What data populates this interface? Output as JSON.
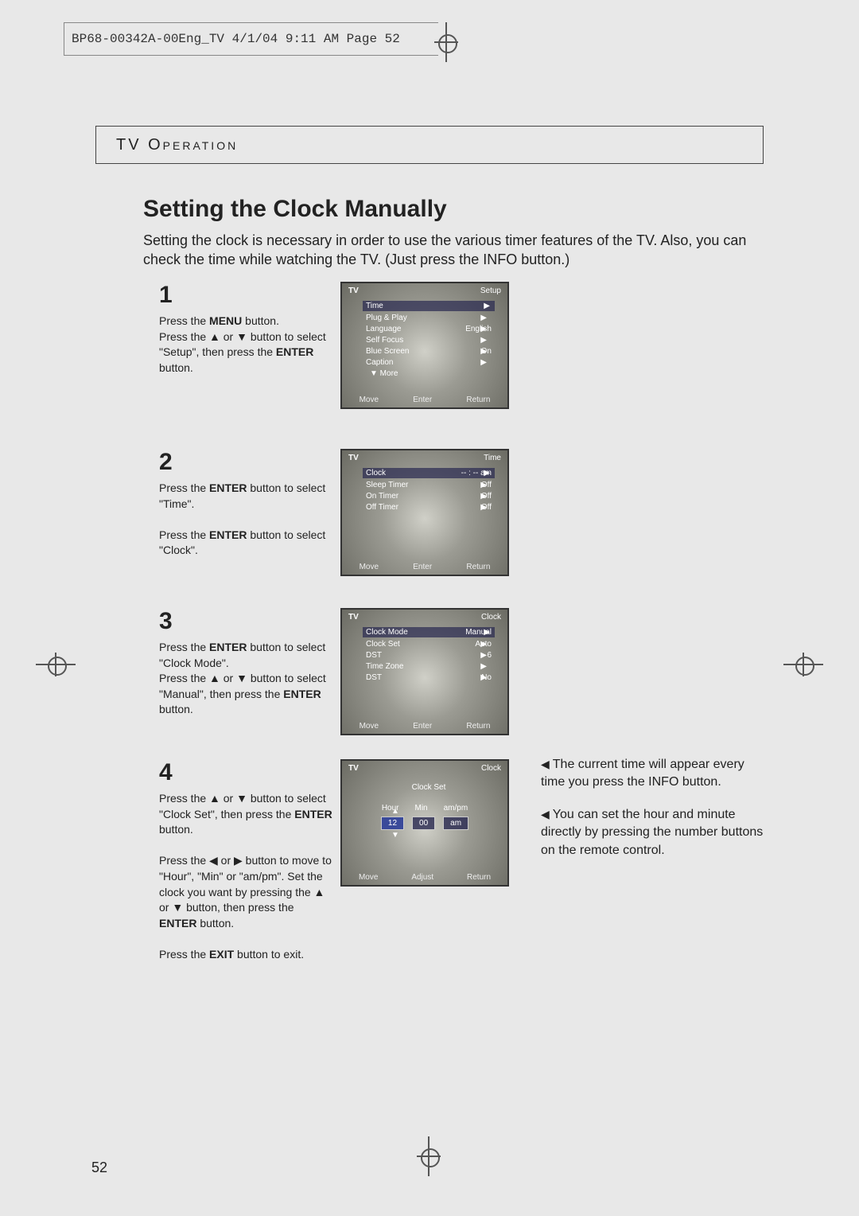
{
  "prepress": {
    "header": "BP68-00342A-00Eng_TV  4/1/04  9:11 AM  Page 52"
  },
  "section_header": "TV Operation",
  "title": "Setting the Clock Manually",
  "intro": "Setting the clock is necessary in order to use the various timer features of the TV. Also, you can check the time while watching the TV. (Just press the INFO button.)",
  "steps": [
    {
      "num": "1",
      "bold1": "MENU",
      "bold2": "ENTER"
    },
    {
      "num": "2",
      "bold1": "ENTER",
      "bold2": "ENTER"
    },
    {
      "num": "3",
      "bold1": "ENTER",
      "bold2": "ENTER"
    },
    {
      "num": "4",
      "bold1": "ENTER",
      "bold2": "ENTER",
      "bold3": "EXIT"
    }
  ],
  "osd": [
    {
      "tl": "TV",
      "tr": "Setup",
      "items": [
        {
          "l": "Time",
          "r": ""
        },
        {
          "l": "Plug & Play",
          "r": ""
        },
        {
          "l": "Language",
          "r": "English"
        },
        {
          "l": "Self Focus",
          "r": ""
        },
        {
          "l": "Blue Screen",
          "r": "On"
        },
        {
          "l": "Caption",
          "r": ""
        }
      ],
      "more": "▼ More"
    },
    {
      "tl": "TV",
      "tr": "Time",
      "items": [
        {
          "l": "Clock",
          "r": "-- : -- am"
        },
        {
          "l": "Sleep Timer",
          "r": "Off"
        },
        {
          "l": "On Timer",
          "r": "Off"
        },
        {
          "l": "Off Timer",
          "r": "Off"
        }
      ]
    },
    {
      "tl": "TV",
      "tr": "Clock",
      "items": [
        {
          "l": "Clock Mode",
          "r": "Manual"
        },
        {
          "l": "Clock Set",
          "r": "Auto"
        },
        {
          "l": "DST",
          "r": "6"
        },
        {
          "l": "Time Zone",
          "r": ""
        },
        {
          "l": "DST",
          "r": "No"
        }
      ]
    },
    {
      "tl": "TV",
      "tr": "Clock",
      "subtitle": "Clock Set",
      "labels": [
        "Hour",
        "Min",
        "am/pm"
      ],
      "values": [
        "12",
        "00",
        "am"
      ]
    }
  ],
  "osd.footer": {},
  "notes": [
    "The current time will appear every time you press the INFO button.",
    "You can set the hour and minute directly by pressing the number buttons on the remote control."
  ],
  "page_number": "52",
  "osd_footer_move": "Move",
  "osd_footer_enter": "Enter",
  "osd_footer_adjust": "Adjust",
  "osd_footer_return": "Return"
}
